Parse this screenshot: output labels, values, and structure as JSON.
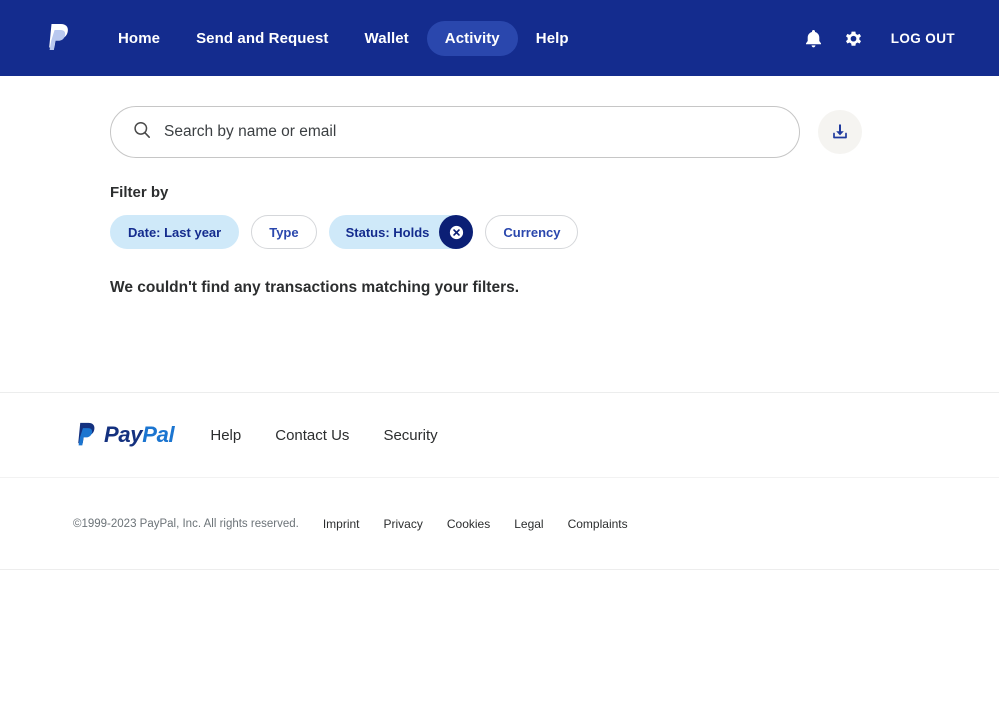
{
  "header": {
    "logo_icon": "paypal-monogram-icon",
    "nav": [
      {
        "label": "Home",
        "active": false
      },
      {
        "label": "Send and Request",
        "active": false
      },
      {
        "label": "Wallet",
        "active": false
      },
      {
        "label": "Activity",
        "active": true
      },
      {
        "label": "Help",
        "active": false
      }
    ],
    "bell_icon": "notification-bell-icon",
    "gear_icon": "settings-gear-icon",
    "logout_label": "LOG OUT",
    "bg_color": "#142c8e",
    "active_pill_color": "#2a47ad"
  },
  "search": {
    "placeholder": "Search by name or email",
    "value": "",
    "icon": "search-icon",
    "download_icon": "download-icon"
  },
  "filters": {
    "label": "Filter by",
    "chips": [
      {
        "label": "Date: Last year",
        "style": "filled",
        "clearable": false
      },
      {
        "label": "Type",
        "style": "outline",
        "clearable": false
      },
      {
        "label": "Status: Holds",
        "style": "filled",
        "clearable": true
      },
      {
        "label": "Currency",
        "style": "outline",
        "clearable": false
      }
    ],
    "clear_icon": "close-x-icon",
    "filled_color": "#cfe9f9",
    "clear_button_color": "#0b1f75"
  },
  "results": {
    "empty_message": "We couldn't find any transactions matching your filters."
  },
  "footer": {
    "logo_text_dark": "Pay",
    "logo_text_light": "Pal",
    "links": [
      {
        "label": "Help"
      },
      {
        "label": "Contact Us"
      },
      {
        "label": "Security"
      }
    ],
    "copyright": "©1999-2023 PayPal, Inc. All rights reserved.",
    "legal_links": [
      {
        "label": "Imprint"
      },
      {
        "label": "Privacy"
      },
      {
        "label": "Cookies"
      },
      {
        "label": "Legal"
      },
      {
        "label": "Complaints"
      }
    ]
  }
}
